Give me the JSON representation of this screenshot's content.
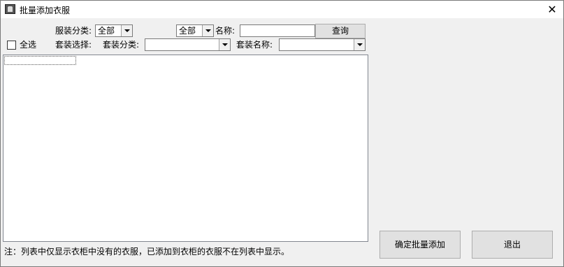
{
  "window": {
    "title": "批量添加衣服",
    "icon": "app-icon",
    "close_glyph": "✕"
  },
  "filters": {
    "clothing_category_label": "服装分类:",
    "clothing_category_value": "全部",
    "second_category_value": "全部",
    "name_label": "名称:",
    "name_value": "",
    "search_button": "查询",
    "select_all_label": "全选",
    "select_all_checked": false,
    "set_select_label": "套装选择:",
    "set_category_label": "套装分类:",
    "set_category_value": "",
    "set_name_label": "套装名称:",
    "set_name_value": ""
  },
  "list": {
    "items": []
  },
  "footer": {
    "note": "注：列表中仅显示衣柜中没有的衣服，已添加到衣柜的衣服不在列表中显示。",
    "confirm_button": "确定批量添加",
    "exit_button": "退出"
  }
}
